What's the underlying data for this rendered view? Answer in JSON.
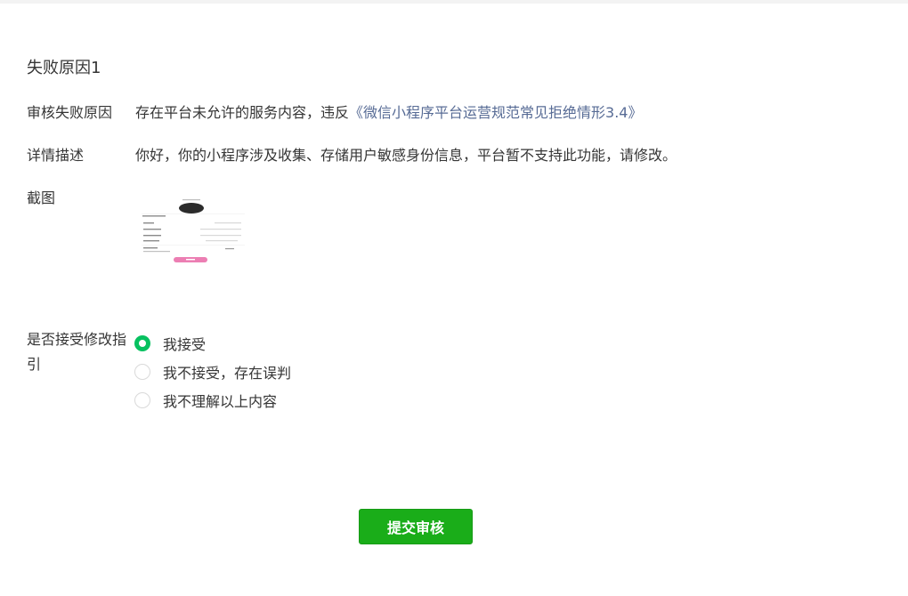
{
  "section_title": "失败原因1",
  "reason": {
    "label": "审核失败原因",
    "text": "存在平台未允许的服务内容，违反",
    "link_text": "《微信小程序平台运营规范常见拒绝情形3.4》"
  },
  "description": {
    "label": "详情描述",
    "text": "你好，你的小程序涉及收集、存储用户敏感身份信息，平台暂不支持此功能，请修改。"
  },
  "screenshot": {
    "label": "截图"
  },
  "accept_guidance": {
    "label": "是否接受修改指引",
    "options": [
      {
        "label": "我接受",
        "checked": true
      },
      {
        "label": "我不接受，存在误判",
        "checked": false
      },
      {
        "label": "我不理解以上内容",
        "checked": false
      }
    ]
  },
  "submit_label": "提交审核",
  "colors": {
    "link": "#576b95",
    "radio_checked": "#07c160",
    "submit_button": "#1aad19"
  }
}
